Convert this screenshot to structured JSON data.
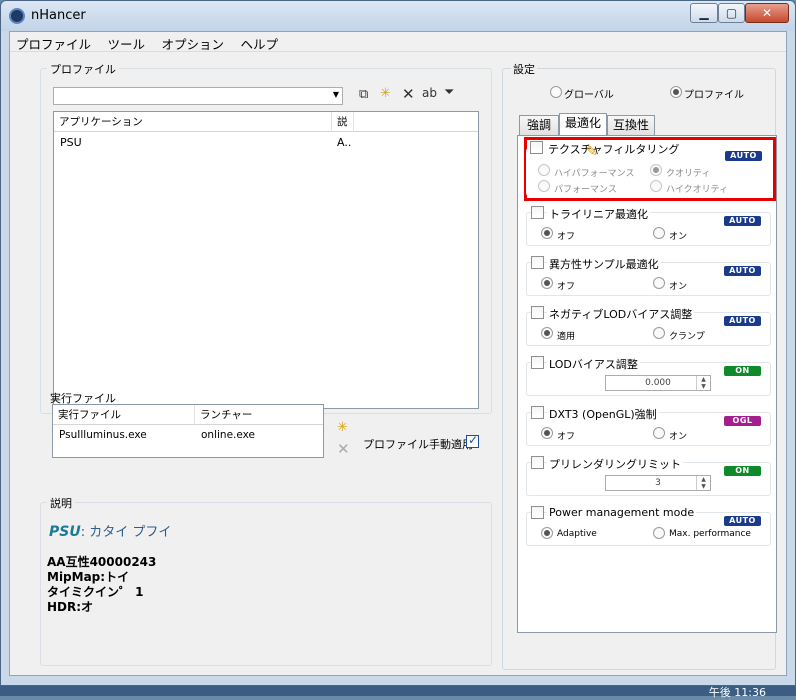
{
  "window": {
    "title": "nHancer"
  },
  "menu": [
    "プロファイル",
    "ツール",
    "オプション",
    "ヘルプ"
  ],
  "profiles": {
    "label": "プロファイル",
    "columns": [
      "アプリケーション",
      "説"
    ],
    "rows": [
      {
        "app": "PSU",
        "desc": "A.."
      }
    ]
  },
  "exec": {
    "label": "実行ファイル",
    "columns": [
      "実行ファイル",
      "ランチャー"
    ],
    "rows": [
      {
        "file": "PsuIlluminus.exe",
        "launcher": "online.exe"
      }
    ],
    "manual_label": "プロファイル手動適用",
    "manual_checked": true
  },
  "description": {
    "label": "説明",
    "name": "PSU",
    "subtitle": ": カタイ プフイ",
    "lines": [
      "AA互性40000243",
      "MipMap:トイ",
      "タイミクイン゜ 1",
      "HDR:オ"
    ]
  },
  "settings": {
    "label": "設定",
    "scope": [
      {
        "label": "グローバル",
        "selected": false
      },
      {
        "label": "プロファイル",
        "selected": true
      }
    ],
    "tabs": [
      {
        "label": "強調",
        "active": false
      },
      {
        "label": "最適化",
        "active": true
      },
      {
        "label": "互換性",
        "active": false
      }
    ],
    "options": [
      {
        "title": "テクスチャフィルタリング",
        "badge": "AUTO",
        "badge_color": "#1a3a8c",
        "type": "radio4",
        "radios": [
          {
            "label": "ハイパフォーマンス",
            "on": false
          },
          {
            "label": "クオリティ",
            "on": true
          },
          {
            "label": "パフォーマンス",
            "on": false
          },
          {
            "label": "ハイクオリティ",
            "on": false
          }
        ]
      },
      {
        "title": "トライリニア最適化",
        "badge": "AUTO",
        "badge_color": "#1a3a8c",
        "type": "radio2",
        "radios": [
          {
            "label": "オフ",
            "on": true
          },
          {
            "label": "オン",
            "on": false
          }
        ]
      },
      {
        "title": "異方性サンプル最適化",
        "badge": "AUTO",
        "badge_color": "#1a3a8c",
        "type": "radio2",
        "radios": [
          {
            "label": "オフ",
            "on": true
          },
          {
            "label": "オン",
            "on": false
          }
        ]
      },
      {
        "title": "ネガティブLODバイアス調整",
        "badge": "AUTO",
        "badge_color": "#1a3a8c",
        "type": "radio2",
        "radios": [
          {
            "label": "適用",
            "on": true
          },
          {
            "label": "クランプ",
            "on": false
          }
        ]
      },
      {
        "title": "LODバイアス調整",
        "badge": "ON",
        "badge_color": "#0e8a2a",
        "type": "spin",
        "value": "0.000"
      },
      {
        "title": "DXT3 (OpenGL)強制",
        "badge": "OGL",
        "badge_color": "#a31e8f",
        "type": "radio2",
        "radios": [
          {
            "label": "オフ",
            "on": true
          },
          {
            "label": "オン",
            "on": false
          }
        ]
      },
      {
        "title": "プリレンダリングリミット",
        "badge": "ON",
        "badge_color": "#0e8a2a",
        "type": "spin",
        "value": "3"
      },
      {
        "title": "Power management mode",
        "badge": "AUTO",
        "badge_color": "#1a3a8c",
        "type": "radio2",
        "radios": [
          {
            "label": "Adaptive",
            "on": true
          },
          {
            "label": "Max. performance",
            "on": false
          }
        ]
      }
    ]
  },
  "taskbar": {
    "time": "午後 11:36"
  },
  "colors": {
    "highlight": "#e60000",
    "accent": "#1f4e93"
  }
}
